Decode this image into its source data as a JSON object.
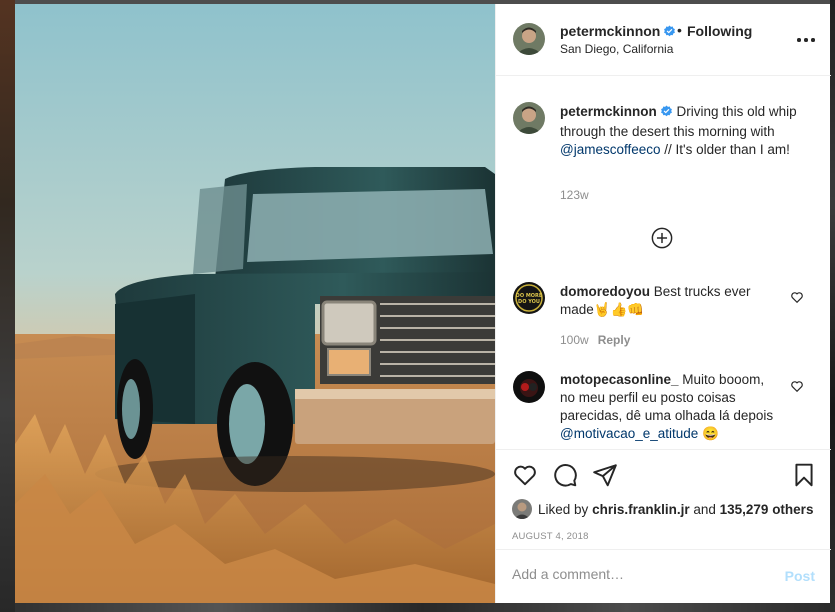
{
  "post": {
    "username": "petermckinnon",
    "follow_separator": "•",
    "follow_status": "Following",
    "location": "San Diego, California"
  },
  "caption": {
    "username": "petermckinnon",
    "text_before": "Driving this old whip through the desert this morning with ",
    "mention": "@jamescoffeeco",
    "text_after": " // It's older than I am!",
    "time": "123w"
  },
  "comments": [
    {
      "username": "domoredoyou",
      "text": "Best trucks ever made🤘👍👊",
      "time": "100w",
      "reply_label": "Reply"
    },
    {
      "username": "motopecasonline_",
      "text_before": "Muito booom, no meu perfil eu posto coisas parecidas, dê uma olhada lá depois ",
      "mention": "@motivacao_e_atitude",
      "text_after": " 😄"
    }
  ],
  "likes": {
    "prefix": "Liked by ",
    "user": "chris.franklin.jr",
    "middle": " and ",
    "count": "135,279 others"
  },
  "date": "AUGUST 4, 2018",
  "comment_box": {
    "placeholder": "Add a comment…",
    "post_label": "Post"
  },
  "colors": {
    "verified": "#3897f0",
    "link": "#00376b",
    "muted": "#8e8e8e",
    "post_disabled": "#b2dffc"
  }
}
